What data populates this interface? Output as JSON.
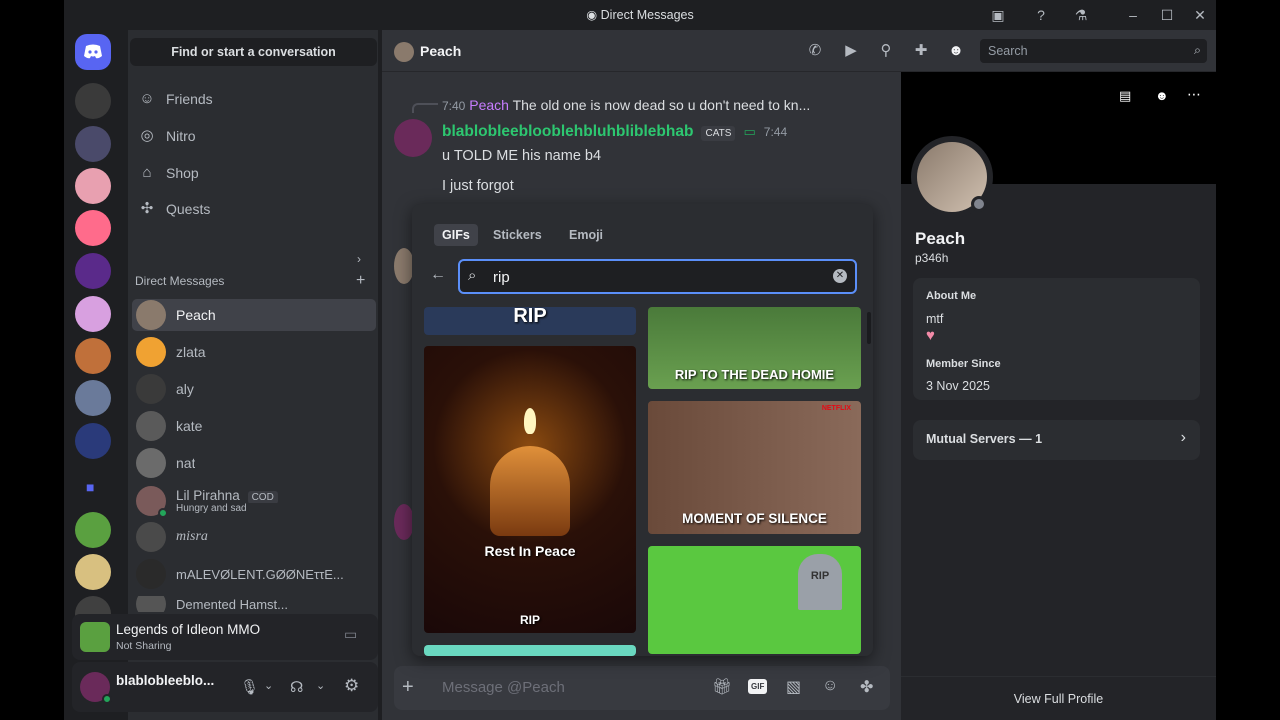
{
  "window": {
    "title": "Direct Messages"
  },
  "sidebar": {
    "find_label": "Find or start a conversation",
    "nav": [
      {
        "label": "Friends",
        "icon": "friends-icon"
      },
      {
        "label": "Nitro",
        "icon": "nitro-icon"
      },
      {
        "label": "Shop",
        "icon": "shop-icon"
      },
      {
        "label": "Quests",
        "icon": "quests-icon"
      }
    ],
    "dm_header": "Direct Messages",
    "dms": [
      {
        "name": "Peach",
        "color": "#8a7a6c"
      },
      {
        "name": "zlata",
        "color": "#f0a232"
      },
      {
        "name": "aly",
        "color": "#3a3a3a"
      },
      {
        "name": "kate",
        "color": "#5a5a5a"
      },
      {
        "name": "nat",
        "color": "#6b6b6b"
      },
      {
        "name": "Lil Pirahna",
        "sub": "Hungry and sad",
        "badge": "COD",
        "color": "#7a5a5a"
      },
      {
        "name": "misra",
        "color": "#4a4a4a"
      },
      {
        "name": "mALEVØLENT.GØØNEττE...",
        "color": "#2a2a2a"
      },
      {
        "name": "Demented Hamst...",
        "color": "#555"
      }
    ],
    "activity": {
      "title": "Legends of Idleon MMO",
      "sub": "Not Sharing"
    },
    "user": {
      "name": "blablobleeblo..."
    }
  },
  "chat": {
    "recipient": "Peach",
    "search_placeholder": "Search",
    "reply": {
      "time": "7:40",
      "author": "Peach",
      "text": "The old one is now dead so u don't need to kn..."
    },
    "message": {
      "author": "blablobleebloobleh bluhbliblebhab",
      "author_display": "blablobleeblooblehbluhbliblebhab",
      "tag": "CATS",
      "time": "7:44",
      "lines": [
        "u TOLD ME his name b4",
        "I just forgot"
      ]
    },
    "composer_placeholder": "Message @Peach"
  },
  "gif_picker": {
    "tabs": [
      "GIFs",
      "Stickers",
      "Emoji"
    ],
    "active_tab": "GIFs",
    "query": "rip",
    "tiles": [
      {
        "caption": "RIP"
      },
      {
        "caption": "RIP TO THE DEAD HOMIE"
      },
      {
        "caption": "Rest In Peace",
        "caption2": "RIP"
      },
      {
        "caption": "MOMENT OF SILENCE",
        "label": "NETFLIX"
      },
      {
        "caption": "RIP"
      }
    ]
  },
  "profile": {
    "name": "Peach",
    "username": "p346h",
    "about_title": "About Me",
    "about_text": "mtf",
    "member_title": "Member Since",
    "member_date": "3 Nov 2025",
    "mutual": "Mutual Servers — 1",
    "view_full": "View Full Profile"
  },
  "colors": {
    "accent": "#5865f2",
    "online": "#23a55a",
    "focus": "#5b8ff9",
    "author_green": "#2dc770"
  }
}
